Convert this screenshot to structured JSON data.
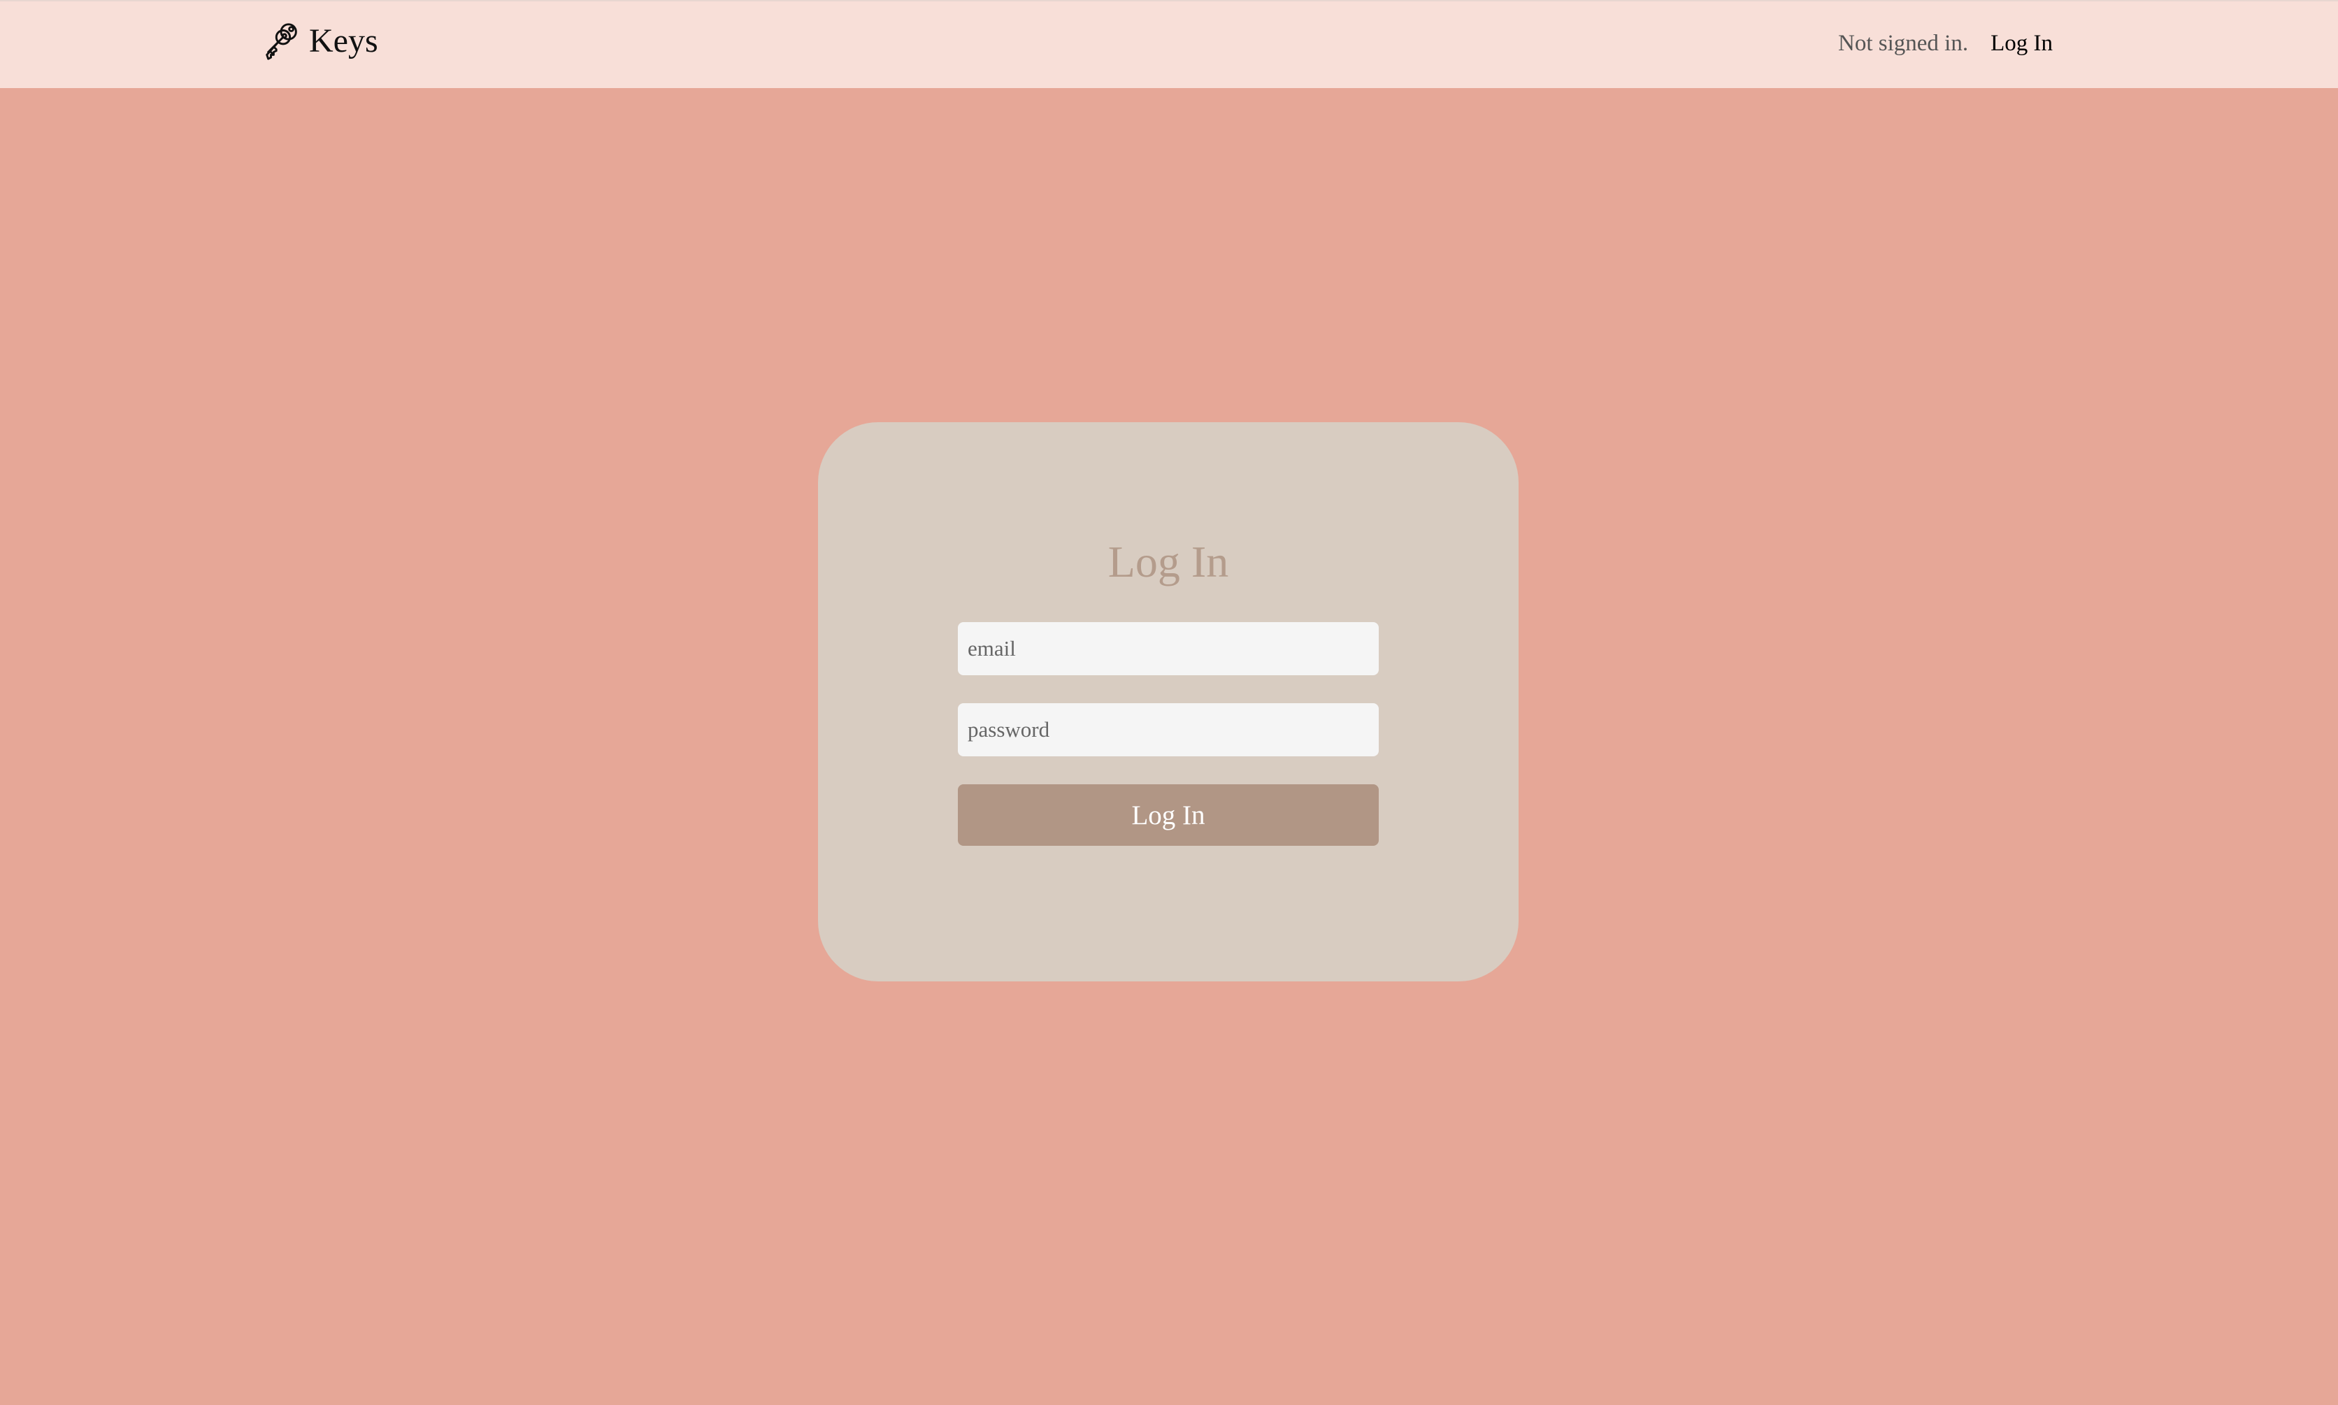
{
  "app": {
    "brand_name": "Keys",
    "brand_icon": "keys-icon"
  },
  "nav": {
    "status_text": "Not signed in.",
    "login_link": "Log In"
  },
  "login_form": {
    "title": "Log In",
    "email_placeholder": "email",
    "email_value": "",
    "password_placeholder": "password",
    "password_value": "",
    "submit_label": "Log In"
  },
  "colors": {
    "page_background": "#e6a797",
    "navbar_background": "#f8dfd8",
    "card_background": "#d8ccc1",
    "title_color": "#b49c8c",
    "button_background": "#b19685",
    "input_background": "#f5f5f5"
  }
}
